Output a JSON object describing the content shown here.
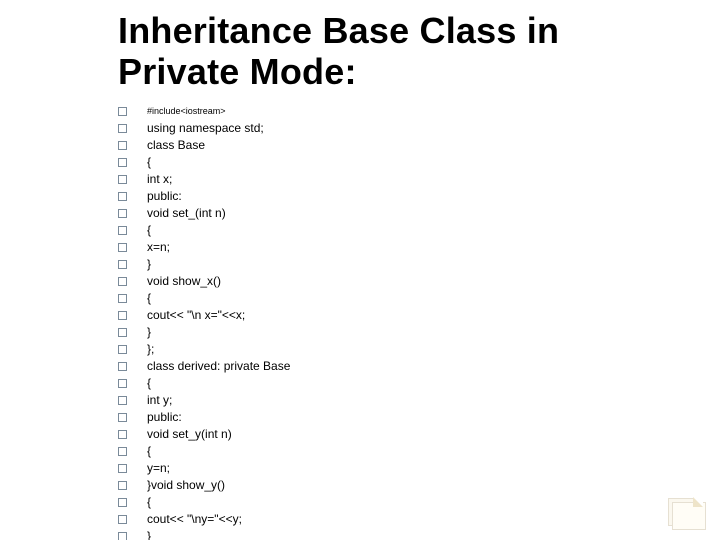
{
  "title": "Inheritance Base Class in Private Mode:",
  "lines": [
    {
      "text": "#include<iostream>",
      "small": true
    },
    {
      "text": "using namespace std;"
    },
    {
      "text": "class Base"
    },
    {
      "text": "{"
    },
    {
      "text": "int x;"
    },
    {
      "text": "public:"
    },
    {
      "text": "void set_(int n)"
    },
    {
      "text": "{"
    },
    {
      "text": "x=n;"
    },
    {
      "text": "}"
    },
    {
      "text": "void show_x()"
    },
    {
      "text": "{"
    },
    {
      "text": "cout<< \"\\n x=\"<<x;"
    },
    {
      "text": "}"
    },
    {
      "text": "};"
    },
    {
      "text": "class derived: private Base"
    },
    {
      "text": "{"
    },
    {
      "text": "int y;"
    },
    {
      "text": "public:"
    },
    {
      "text": "void set_y(int n)"
    },
    {
      "text": "{"
    },
    {
      "text": "y=n;"
    },
    {
      "text": "}void show_y()"
    },
    {
      "text": "{"
    },
    {
      "text": "cout<< \"\\ny=\"<<y;"
    },
    {
      "text": "}"
    }
  ]
}
